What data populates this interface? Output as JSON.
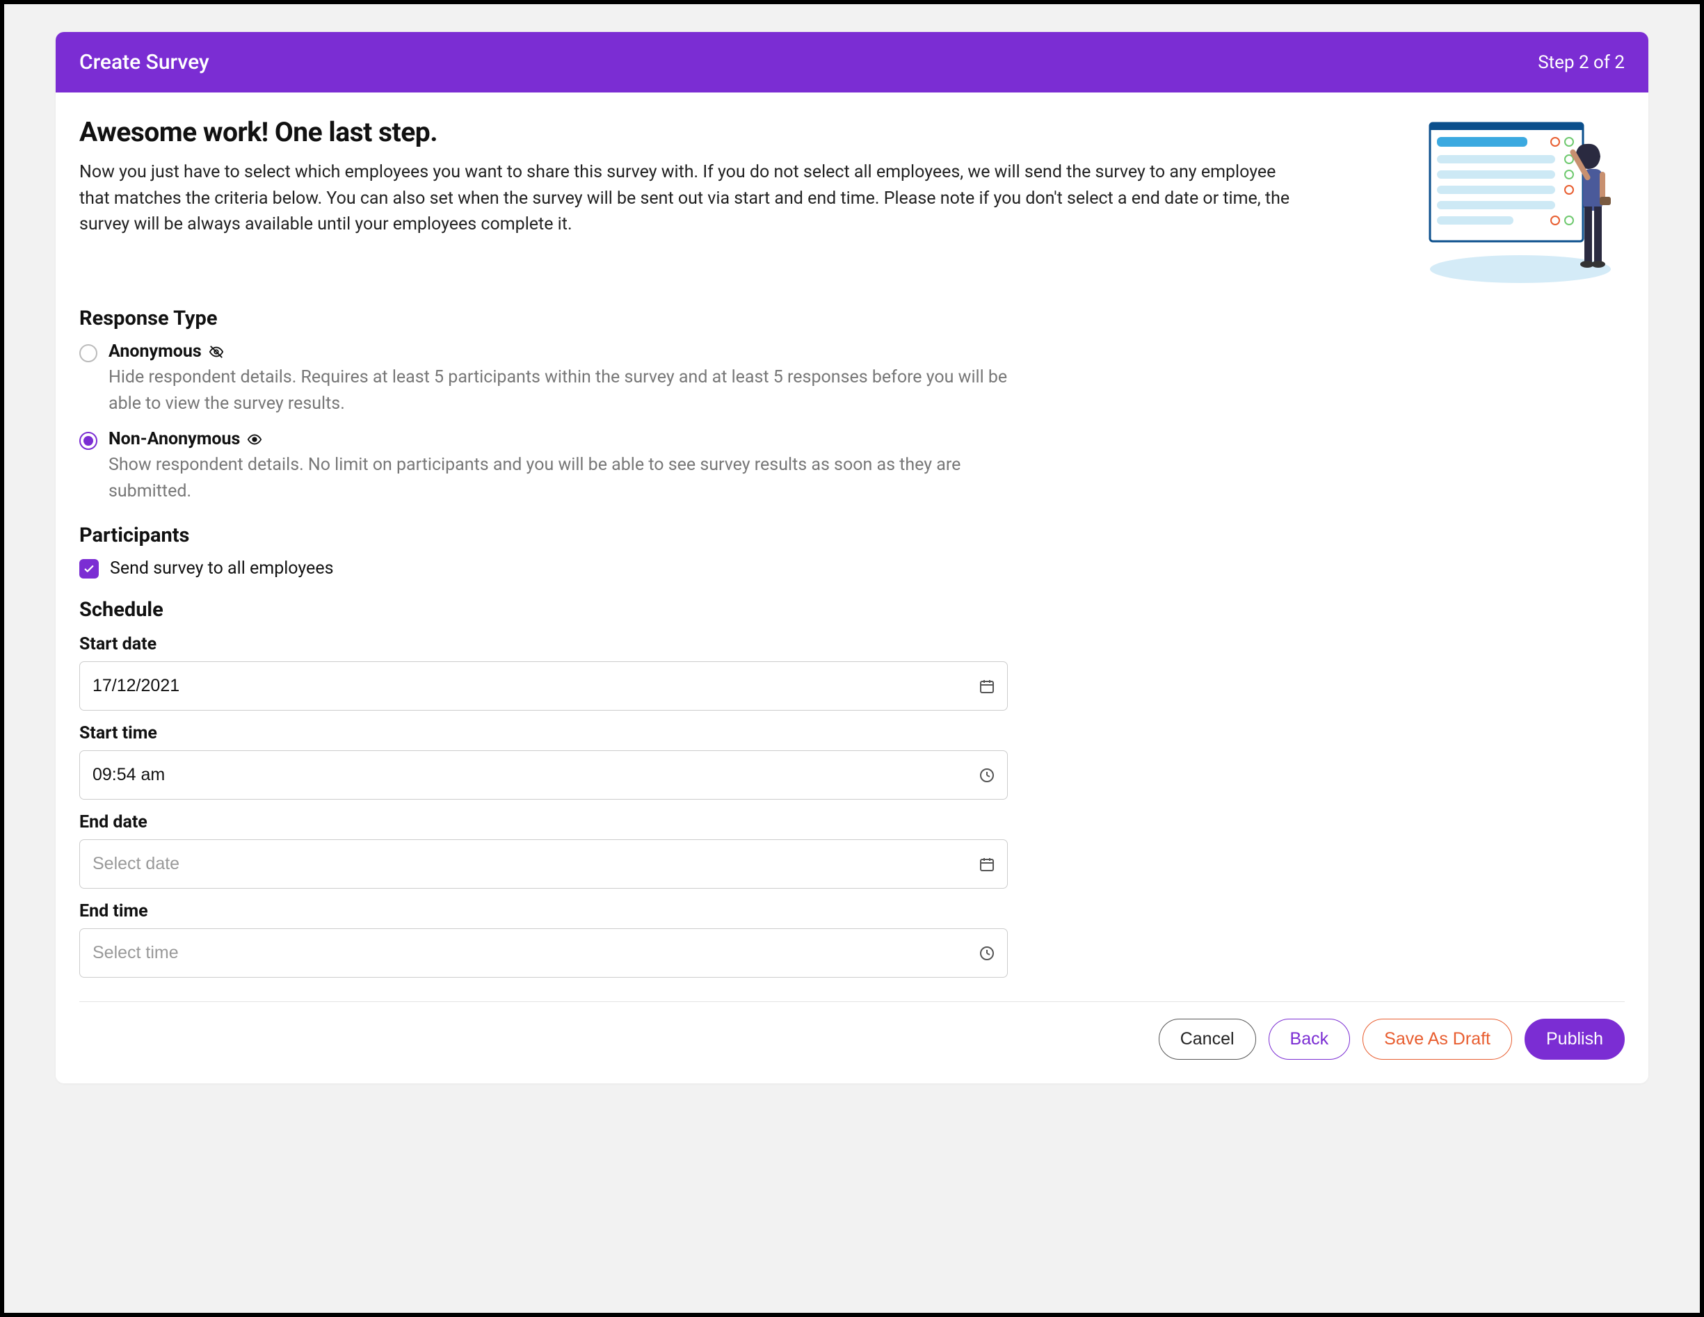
{
  "header": {
    "title": "Create Survey",
    "step": "Step 2 of 2"
  },
  "intro": {
    "heading": "Awesome work! One last step.",
    "body": "Now you just have to select which employees you want to share this survey with. If you do not select all employees, we will send the survey to any employee that matches the criteria below. You can also set when the survey will be sent out via start and end time. Please note if you don't select a end date or time, the survey will be always available until your employees complete it."
  },
  "response_type": {
    "title": "Response Type",
    "anonymous": {
      "label": "Anonymous",
      "desc": "Hide respondent details. Requires at least 5 participants within the survey and at least 5 responses before you will be able to view the survey results.",
      "selected": false
    },
    "non_anonymous": {
      "label": "Non-Anonymous",
      "desc": "Show respondent details. No limit on participants and you will be able to see survey results as soon as they are submitted.",
      "selected": true
    }
  },
  "participants": {
    "title": "Participants",
    "all_label": "Send survey to all employees",
    "all_checked": true
  },
  "schedule": {
    "title": "Schedule",
    "start_date_label": "Start date",
    "start_date_value": "17/12/2021",
    "start_time_label": "Start time",
    "start_time_value": "09:54 am",
    "end_date_label": "End date",
    "end_date_placeholder": "Select date",
    "end_time_label": "End time",
    "end_time_placeholder": "Select time"
  },
  "actions": {
    "cancel": "Cancel",
    "back": "Back",
    "save_draft": "Save As Draft",
    "publish": "Publish"
  }
}
